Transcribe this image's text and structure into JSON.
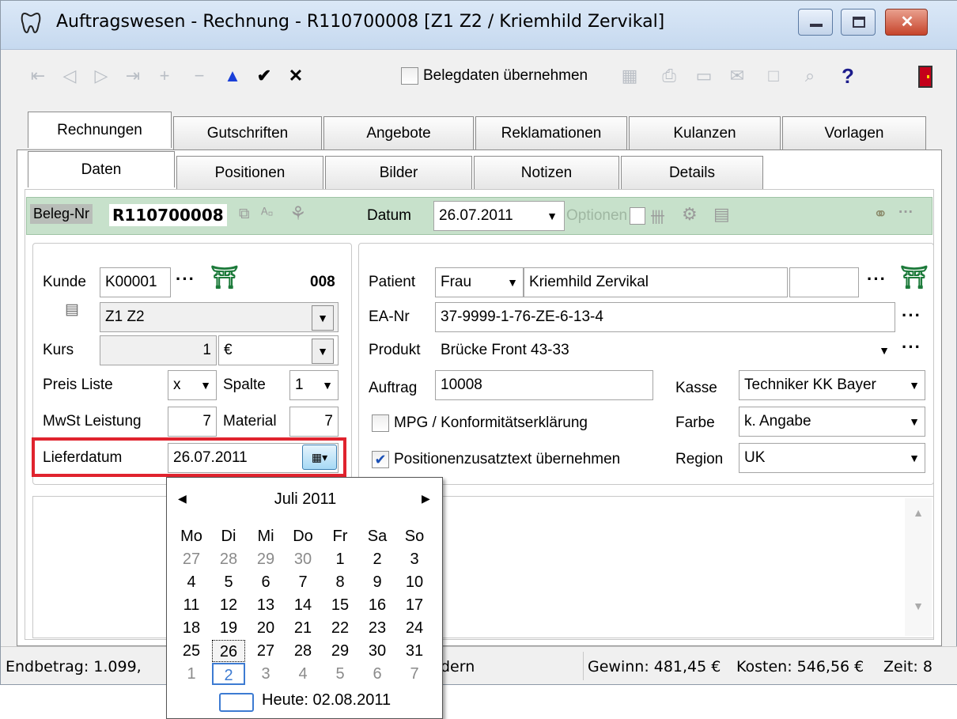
{
  "window": {
    "title": "Auftragswesen - Rechnung - R110700008 [Z1 Z2 / Kriemhild Zervikal]"
  },
  "toolbar": {
    "first_icon": "first-record-icon",
    "prev_icon": "previous-record-icon",
    "next_icon": "next-record-icon",
    "last_icon": "last-record-icon",
    "add_icon": "add-icon",
    "delete_icon": "delete-icon",
    "up_icon": "up-arrow-icon",
    "ok_icon": "checkmark-icon",
    "cancel_icon": "cancel-icon",
    "belegdaten_label": "Belegdaten übernehmen",
    "help_label": "?"
  },
  "main_tabs": [
    {
      "label": "Rechnungen",
      "active": true
    },
    {
      "label": "Gutschriften"
    },
    {
      "label": "Angebote"
    },
    {
      "label": "Reklamationen"
    },
    {
      "label": "Kulanzen"
    },
    {
      "label": "Vorlagen"
    }
  ],
  "sub_tabs": [
    {
      "label": "Daten",
      "active": true
    },
    {
      "label": "Positionen"
    },
    {
      "label": "Bilder"
    },
    {
      "label": "Notizen"
    },
    {
      "label": "Details"
    }
  ],
  "header": {
    "beleg_label": "Beleg-Nr",
    "beleg_value": "R110700008",
    "datum_label": "Datum",
    "datum_value": "26.07.2011",
    "optionen_label": "Optionen"
  },
  "left": {
    "kunde_label": "Kunde",
    "kunde_value": "K00001",
    "kunde_number": "008",
    "kunde_name": "Z1 Z2",
    "kurs_label": "Kurs",
    "kurs_value": "1",
    "kurs_currency": "€",
    "preisliste_label": "Preis Liste",
    "preisliste_value": "x",
    "spalte_label": "Spalte",
    "spalte_value": "1",
    "mwst_label": "MwSt Leistung",
    "mwst_value": "7",
    "material_label": "Material",
    "material_value": "7",
    "lieferdatum_label": "Lieferdatum",
    "lieferdatum_value": "26.07.2011"
  },
  "right": {
    "patient_label": "Patient",
    "patient_salutation": "Frau",
    "patient_name": "Kriemhild Zervikal",
    "eanr_label": "EA-Nr",
    "eanr_value": "37-9999-1-76-ZE-6-13-4",
    "produkt_label": "Produkt",
    "produkt_value": "Brücke Front 43-33",
    "auftrag_label": "Auftrag",
    "auftrag_value": "10008",
    "kasse_label": "Kasse",
    "kasse_value": "Techniker KK Bayer",
    "mpg_label": "MPG / Konformitätserklärung",
    "mpg_checked": false,
    "farbe_label": "Farbe",
    "farbe_value": "k. Angabe",
    "pos_label": "Positionenzusatztext übernehmen",
    "pos_checked": true,
    "region_label": "Region",
    "region_value": "UK"
  },
  "calendar": {
    "month": "Juli 2011",
    "weekdays": [
      "Mo",
      "Di",
      "Mi",
      "Do",
      "Fr",
      "Sa",
      "So"
    ],
    "weeks": [
      [
        "27",
        "28",
        "29",
        "30",
        "1",
        "2",
        "3"
      ],
      [
        "4",
        "5",
        "6",
        "7",
        "8",
        "9",
        "10"
      ],
      [
        "11",
        "12",
        "13",
        "14",
        "15",
        "16",
        "17"
      ],
      [
        "18",
        "19",
        "20",
        "21",
        "22",
        "23",
        "24"
      ],
      [
        "25",
        "26",
        "27",
        "28",
        "29",
        "30",
        "31"
      ],
      [
        "1",
        "2",
        "3",
        "4",
        "5",
        "6",
        "7"
      ]
    ],
    "selected": "26",
    "today_label": "Heute: 02.08.2011"
  },
  "status": {
    "endbetrag": "Endbetrag: 1.099,",
    "middle": "dern",
    "gewinn": "Gewinn: 481,45 €",
    "kosten": "Kosten: 546,56 €",
    "zeit": "Zeit: 8"
  },
  "colors": {
    "highlight": "#e0232e",
    "green_bar": "#c7e1cb",
    "checkbox_accent": "#1a4fb5"
  }
}
